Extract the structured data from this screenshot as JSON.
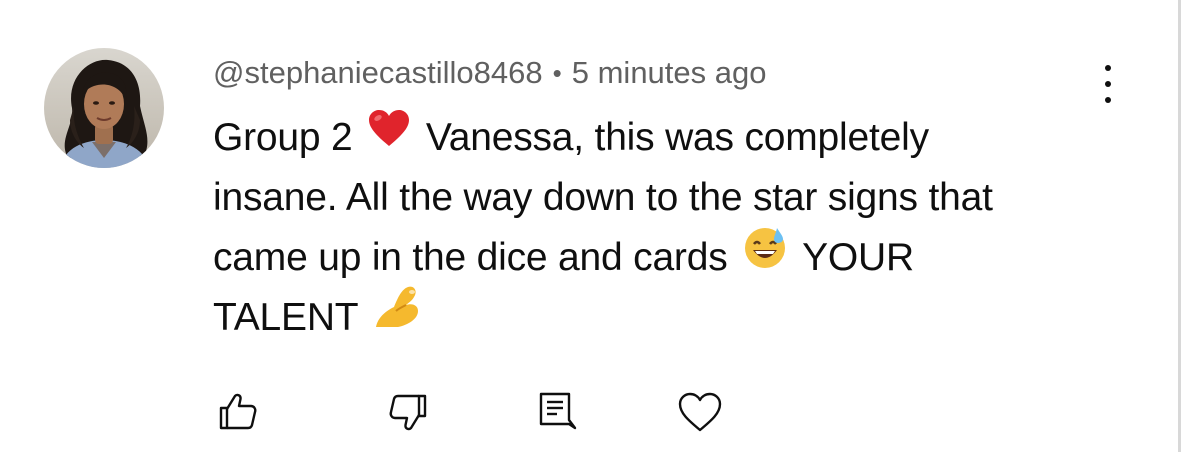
{
  "comment": {
    "author": "@stephaniecastillo8468",
    "separator": "•",
    "time": "5 minutes ago",
    "text_lines": [
      [
        "Group 2",
        "Vanessa, this was completely"
      ],
      [
        "insane. All the way down to the star signs that"
      ],
      [
        "came up in the dice and cards",
        "YOUR"
      ],
      [
        "TALENT"
      ]
    ],
    "emojis": [
      "red-heart",
      "grinning-sweat",
      "pinching-hand"
    ]
  },
  "icons": {
    "avatar": "avatar-photo",
    "menu": "more-vert-icon",
    "like": "thumbs-up-icon",
    "dislike": "thumbs-down-icon",
    "reply": "reply-comment-icon",
    "heart": "heart-icon"
  },
  "colors": {
    "text": "#0f0f0f",
    "meta": "#606060",
    "heart": "#e0242c",
    "emoji_yellow": "#f6c342"
  }
}
